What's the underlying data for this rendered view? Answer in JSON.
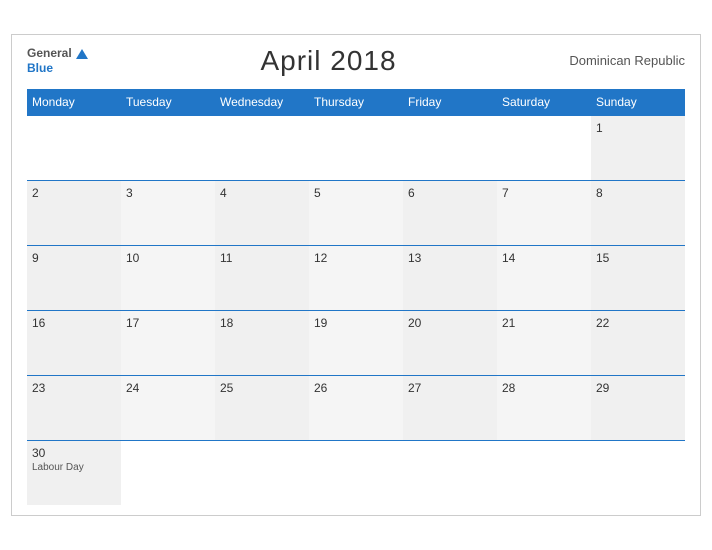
{
  "header": {
    "logo_general": "General",
    "logo_blue": "Blue",
    "month_title": "April 2018",
    "country": "Dominican Republic"
  },
  "weekdays": [
    "Monday",
    "Tuesday",
    "Wednesday",
    "Thursday",
    "Friday",
    "Saturday",
    "Sunday"
  ],
  "weeks": [
    [
      {
        "num": "",
        "event": ""
      },
      {
        "num": "",
        "event": ""
      },
      {
        "num": "",
        "event": ""
      },
      {
        "num": "",
        "event": ""
      },
      {
        "num": "",
        "event": ""
      },
      {
        "num": "",
        "event": ""
      },
      {
        "num": "1",
        "event": ""
      }
    ],
    [
      {
        "num": "2",
        "event": ""
      },
      {
        "num": "3",
        "event": ""
      },
      {
        "num": "4",
        "event": ""
      },
      {
        "num": "5",
        "event": ""
      },
      {
        "num": "6",
        "event": ""
      },
      {
        "num": "7",
        "event": ""
      },
      {
        "num": "8",
        "event": ""
      }
    ],
    [
      {
        "num": "9",
        "event": ""
      },
      {
        "num": "10",
        "event": ""
      },
      {
        "num": "11",
        "event": ""
      },
      {
        "num": "12",
        "event": ""
      },
      {
        "num": "13",
        "event": ""
      },
      {
        "num": "14",
        "event": ""
      },
      {
        "num": "15",
        "event": ""
      }
    ],
    [
      {
        "num": "16",
        "event": ""
      },
      {
        "num": "17",
        "event": ""
      },
      {
        "num": "18",
        "event": ""
      },
      {
        "num": "19",
        "event": ""
      },
      {
        "num": "20",
        "event": ""
      },
      {
        "num": "21",
        "event": ""
      },
      {
        "num": "22",
        "event": ""
      }
    ],
    [
      {
        "num": "23",
        "event": ""
      },
      {
        "num": "24",
        "event": ""
      },
      {
        "num": "25",
        "event": ""
      },
      {
        "num": "26",
        "event": ""
      },
      {
        "num": "27",
        "event": ""
      },
      {
        "num": "28",
        "event": ""
      },
      {
        "num": "29",
        "event": ""
      }
    ],
    [
      {
        "num": "30",
        "event": "Labour Day"
      },
      {
        "num": "",
        "event": ""
      },
      {
        "num": "",
        "event": ""
      },
      {
        "num": "",
        "event": ""
      },
      {
        "num": "",
        "event": ""
      },
      {
        "num": "",
        "event": ""
      },
      {
        "num": "",
        "event": ""
      }
    ]
  ]
}
